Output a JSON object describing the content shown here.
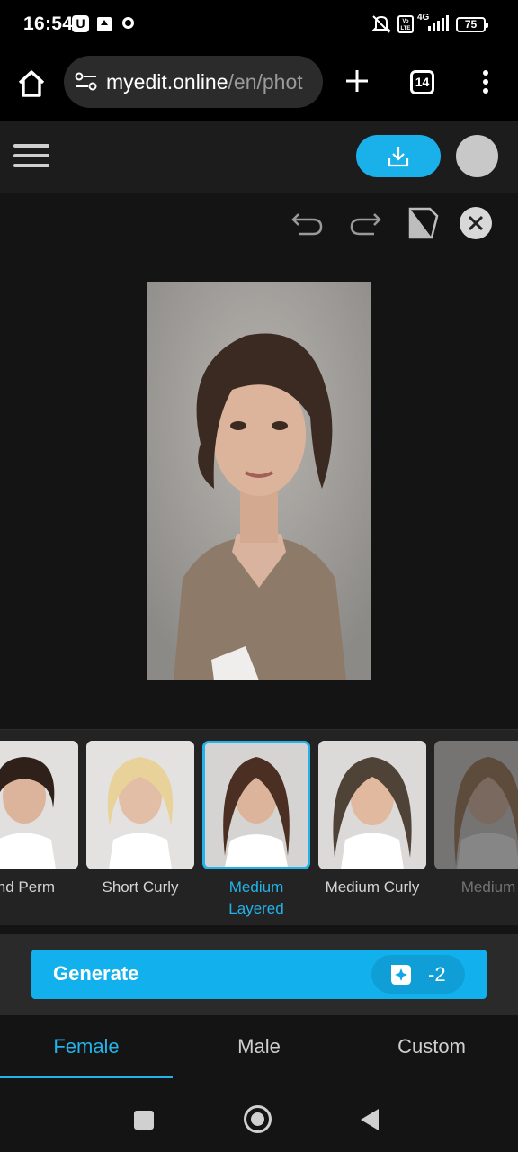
{
  "status_bar": {
    "time": "16:54",
    "notification_u": "U",
    "volte": "Vo LTE",
    "network": "4G",
    "battery": "75"
  },
  "browser": {
    "url_domain": "myedit.online",
    "url_path": "/en/phot",
    "tab_count": "14"
  },
  "styles": [
    {
      "label": "ind Perm",
      "selected": false
    },
    {
      "label": "Short Curly",
      "selected": false
    },
    {
      "label": "Medium Layered",
      "selected": true
    },
    {
      "label": "Medium Curly",
      "selected": false
    },
    {
      "label": "Medium",
      "selected": false
    }
  ],
  "generate": {
    "label": "Generate",
    "credits": "-2"
  },
  "gender_tabs": [
    {
      "label": "Female",
      "active": true
    },
    {
      "label": "Male",
      "active": false
    },
    {
      "label": "Custom",
      "active": false
    }
  ],
  "colors": {
    "accent": "#1ab0ea",
    "background": "#141414"
  }
}
